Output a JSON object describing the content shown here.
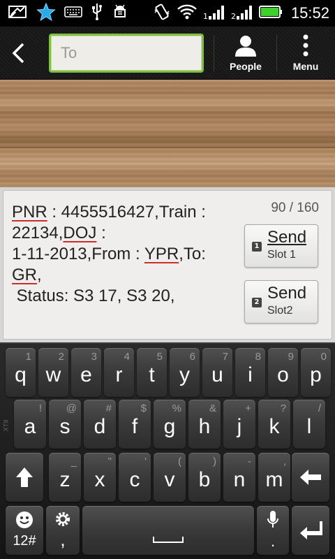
{
  "status_bar": {
    "time": "15:52",
    "icons": [
      "sync-icon",
      "star-icon",
      "keyboard-icon",
      "usb-icon",
      "android-debug-icon",
      "vibrate-icon",
      "wifi-icon",
      "signal-1-icon",
      "signal-2-icon",
      "battery-icon"
    ]
  },
  "action_bar": {
    "to_placeholder": "To",
    "people_label": "People",
    "menu_label": "Menu"
  },
  "compose": {
    "counter": "90 / 160",
    "message_parts": [
      {
        "text": "PNR",
        "underline": true
      },
      {
        "text": " : 4455516427,Train :\n22134,",
        "underline": false
      },
      {
        "text": "DOJ",
        "underline": true
      },
      {
        "text": " :\n1-11-2013,From : ",
        "underline": false
      },
      {
        "text": "YPR",
        "underline": true
      },
      {
        "text": ",To:\n",
        "underline": false
      },
      {
        "text": "GR",
        "underline": true
      },
      {
        "text": ",\n Status: S3 17, S3 20,",
        "underline": false
      }
    ],
    "send_slot1": {
      "label": "Send",
      "sub": "Slot 1",
      "num": "1"
    },
    "send_slot2": {
      "label": "Send",
      "sub": "Slot2",
      "num": "2"
    }
  },
  "keyboard": {
    "side_label": "XT9",
    "row1": [
      {
        "main": "q",
        "alt": "1"
      },
      {
        "main": "w",
        "alt": "2"
      },
      {
        "main": "e",
        "alt": "3"
      },
      {
        "main": "r",
        "alt": "4"
      },
      {
        "main": "t",
        "alt": "5"
      },
      {
        "main": "y",
        "alt": "6"
      },
      {
        "main": "u",
        "alt": "7"
      },
      {
        "main": "i",
        "alt": "8"
      },
      {
        "main": "o",
        "alt": "9"
      },
      {
        "main": "p",
        "alt": "0"
      }
    ],
    "row2": [
      {
        "main": "a",
        "alt": "!"
      },
      {
        "main": "s",
        "alt": "@"
      },
      {
        "main": "d",
        "alt": "#"
      },
      {
        "main": "f",
        "alt": "$"
      },
      {
        "main": "g",
        "alt": "%"
      },
      {
        "main": "h",
        "alt": "&"
      },
      {
        "main": "j",
        "alt": "+"
      },
      {
        "main": "k",
        "alt": "?"
      },
      {
        "main": "l",
        "alt": "/"
      }
    ],
    "row3": [
      {
        "main": "z",
        "alt": "_"
      },
      {
        "main": "x",
        "alt": "\""
      },
      {
        "main": "c",
        "alt": "'"
      },
      {
        "main": "v",
        "alt": "("
      },
      {
        "main": "b",
        "alt": ")"
      },
      {
        "main": "n",
        "alt": "-"
      },
      {
        "main": "m",
        "alt": ","
      }
    ],
    "num_key": "12#",
    "comma_key": ",",
    "period_key": "."
  },
  "colors": {
    "accent_green": "#7fbf3f",
    "spell_underline": "#d12c2c"
  }
}
